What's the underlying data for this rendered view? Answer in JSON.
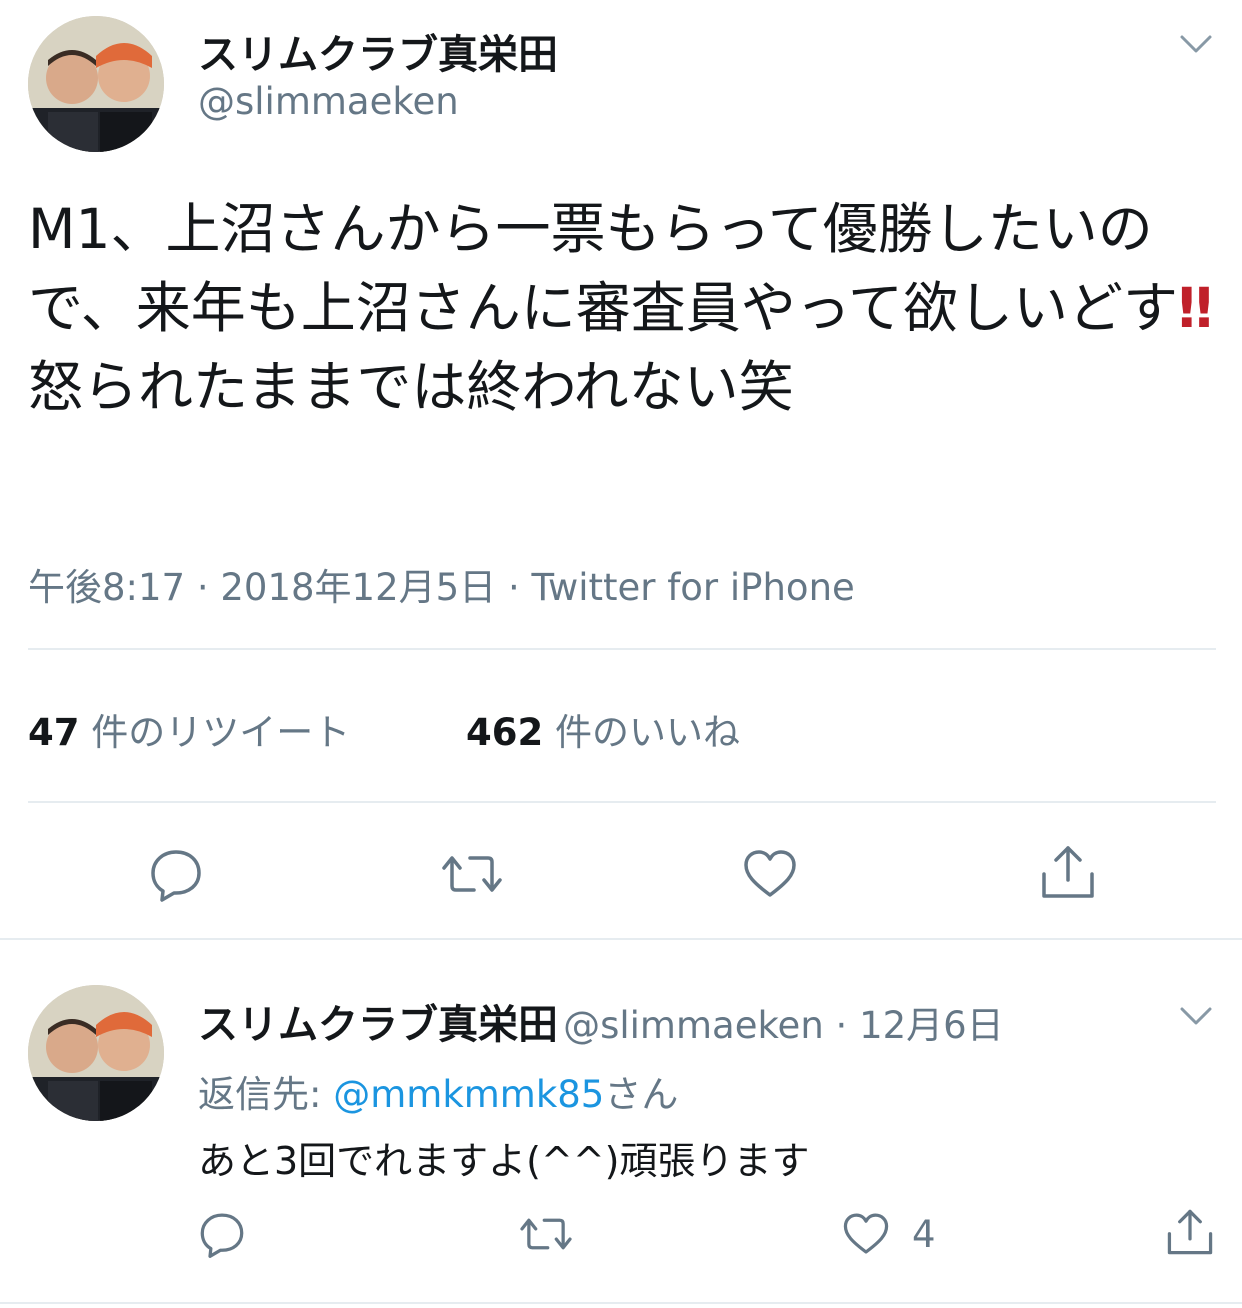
{
  "tweet": {
    "author_name": "スリムクラブ真栄田",
    "author_handle": "@slimmaeken",
    "text_part1": "M1、上沼さんから一票もらって優勝したいので、来年も上沼さんに審査員やって欲しいどす",
    "emoji": "‼",
    "text_part2": "怒られたままでは終われない笑",
    "time": "午後8:17",
    "sep1": " · ",
    "date": "2018年12月5日",
    "sep2": " · ",
    "source": "Twitter for iPhone",
    "retweet_count": "47",
    "retweet_label": " 件のリツイート",
    "like_count": "462",
    "like_label": " 件のいいね",
    "icons": [
      "avatar",
      "chevron-down-icon",
      "reply-icon",
      "retweet-icon",
      "like-icon",
      "share-icon"
    ]
  },
  "reply": {
    "author_name": "スリムクラブ真栄田",
    "author_handle": "@slimmaeken",
    "dot": " · ",
    "date": "12月6日",
    "reply_to_label": "返信先: ",
    "reply_to_mention": "@mmkmmk85",
    "reply_to_suffix": "さん",
    "text": "あと3回でれますよ(^^)頑張ります",
    "like_count": "4"
  },
  "colors": {
    "text": "#14171a",
    "secondary": "#657786",
    "link": "#1b95e0",
    "divider": "#e6ecf0",
    "emoji_red": "#c0202a"
  }
}
